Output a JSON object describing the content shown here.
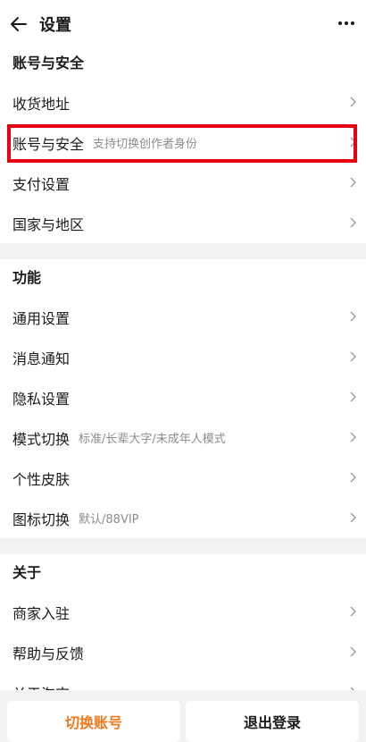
{
  "header": {
    "title": "设置"
  },
  "sections": [
    {
      "title": "账号与安全",
      "items": [
        {
          "label": "收货地址",
          "sub": ""
        },
        {
          "label": "账号与安全",
          "sub": "支持切换创作者身份"
        },
        {
          "label": "支付设置",
          "sub": ""
        },
        {
          "label": "国家与地区",
          "sub": ""
        }
      ]
    },
    {
      "title": "功能",
      "items": [
        {
          "label": "通用设置",
          "sub": ""
        },
        {
          "label": "消息通知",
          "sub": ""
        },
        {
          "label": "隐私设置",
          "sub": ""
        },
        {
          "label": "模式切换",
          "sub": "标准/长辈大字/未成年人模式"
        },
        {
          "label": "个性皮肤",
          "sub": ""
        },
        {
          "label": "图标切换",
          "sub": "默认/88VIP"
        }
      ]
    },
    {
      "title": "关于",
      "items": [
        {
          "label": "商家入驻",
          "sub": ""
        },
        {
          "label": "帮助与反馈",
          "sub": ""
        },
        {
          "label": "关于淘宝",
          "sub": ""
        }
      ]
    }
  ],
  "footer": {
    "switch_label": "切换账号",
    "logout_label": "退出登录"
  },
  "colors": {
    "highlight": "#e60012",
    "switch_text": "#f07a1c"
  }
}
